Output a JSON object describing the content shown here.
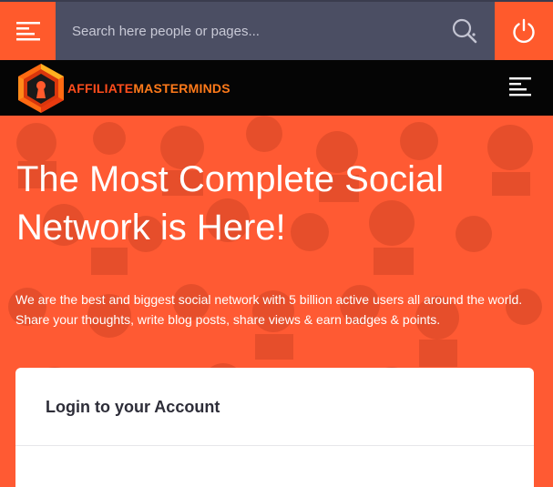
{
  "search": {
    "placeholder": "Search here people or pages..."
  },
  "icons": {
    "menu": "menu-icon",
    "search": "search-icon",
    "power": "power-icon",
    "secondary_menu": "menu-icon",
    "logo": "keyhole-hexagon-logo"
  },
  "brand": {
    "part1": "AFFILIATE",
    "part2": "MASTERMINDS",
    "colors": {
      "primary": "#ff5a2c",
      "topbar": "#4b4e63",
      "logobar": "#050505"
    }
  },
  "hero": {
    "title": "The Most Complete Social Network is Here!",
    "subtitle": "We are the best and biggest social network with 5 billion active users all around the world. Share your thoughts, write blog posts, share views & earn badges & points."
  },
  "login": {
    "title": "Login to your Account"
  }
}
